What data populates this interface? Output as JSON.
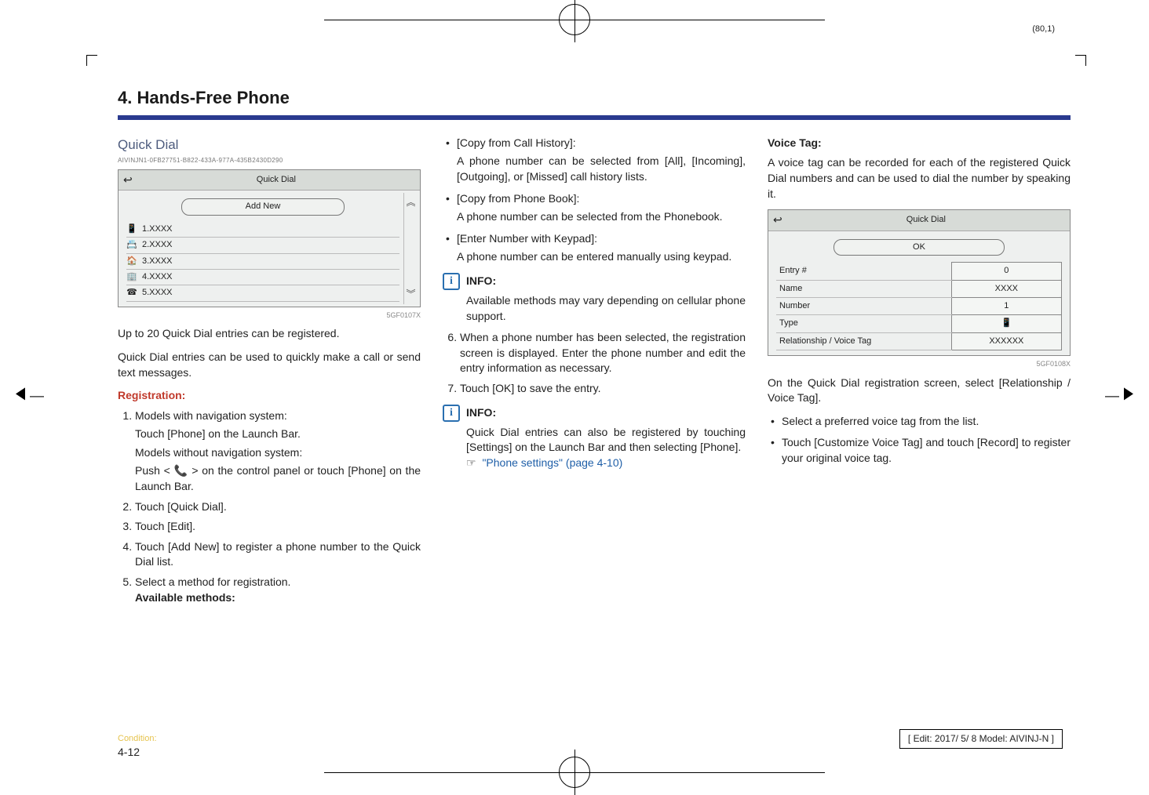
{
  "page_marker_top": "(80,1)",
  "chapter_title": "4. Hands-Free Phone",
  "section_heading": "Quick Dial",
  "doc_code": "AIVINJN1-0FB27751-B822-433A-977A-435B2430D290",
  "figure1": {
    "header_title": "Quick Dial",
    "add_new_button": "Add New",
    "rows": [
      {
        "icon": "📱",
        "label": "1.XXXX"
      },
      {
        "icon": "📇",
        "label": "2.XXXX"
      },
      {
        "icon": "🏠",
        "label": "3.XXXX"
      },
      {
        "icon": "🏢",
        "label": "4.XXXX"
      },
      {
        "icon": "☎",
        "label": "5.XXXX"
      }
    ],
    "caption": "5GF0107X"
  },
  "para1": "Up to 20 Quick Dial entries can be registered.",
  "para2": "Quick Dial entries can be used to quickly make a call or send text messages.",
  "registration_heading": "Registration:",
  "steps": {
    "s1a": "Models with navigation system:",
    "s1b": "Touch [Phone] on the Launch Bar.",
    "s1c": "Models without navigation system:",
    "s1d_pre": "Push <",
    "s1d_post": "> on the control panel or touch [Phone] on the Launch Bar.",
    "s2": "Touch [Quick Dial].",
    "s3": "Touch [Edit].",
    "s4": "Touch [Add New] to register a phone number to the Quick Dial list.",
    "s5": "Select a method for registration.",
    "s5_bold": "Available methods:"
  },
  "methods": {
    "m1_title": "[Copy from Call History]:",
    "m1_body": "A phone number can be selected from [All], [Incoming], [Outgoing], or [Missed] call history lists.",
    "m2_title": "[Copy from Phone Book]:",
    "m2_body": "A phone number can be selected from the Phonebook.",
    "m3_title": "[Enter Number with Keypad]:",
    "m3_body": "A phone number can be entered manually using keypad."
  },
  "info_label": "INFO:",
  "info1_body": "Available methods may vary depending on cellular phone support.",
  "step6": "When a phone number has been selected, the registration screen is displayed. Enter the phone number and edit the entry information as necessary.",
  "step7": "Touch [OK] to save the entry.",
  "info2_body": "Quick Dial entries can also be registered by touching [Settings] on the Launch Bar and then selecting [Phone].",
  "link_text": "\"Phone settings\" (page 4-10)",
  "voice_tag_heading": "Voice Tag:",
  "voice_tag_para": "A voice tag can be recorded for each of the registered Quick Dial numbers and can be used to dial the number by speaking it.",
  "figure2": {
    "header_title": "Quick Dial",
    "ok_button": "OK",
    "rows": [
      {
        "label": "Entry #",
        "value": "0"
      },
      {
        "label": "Name",
        "value": "XXXX"
      },
      {
        "label": "Number",
        "value": "1"
      },
      {
        "label": "Type",
        "value": "📱"
      },
      {
        "label": "Relationship / Voice Tag",
        "value": "XXXXXX"
      }
    ],
    "caption": "5GF0108X"
  },
  "after_fig2": "On the Quick Dial registration screen, select [Relationship / Voice Tag].",
  "vt_bullets": {
    "b1": "Select a preferred voice tag from the list.",
    "b2": "Touch [Customize Voice Tag] and touch [Record] to register your original voice tag."
  },
  "page_number": "4-12",
  "condition_label": "Condition:",
  "edit_box": "[ Edit: 2017/ 5/ 8   Model: AIVINJ-N ]"
}
